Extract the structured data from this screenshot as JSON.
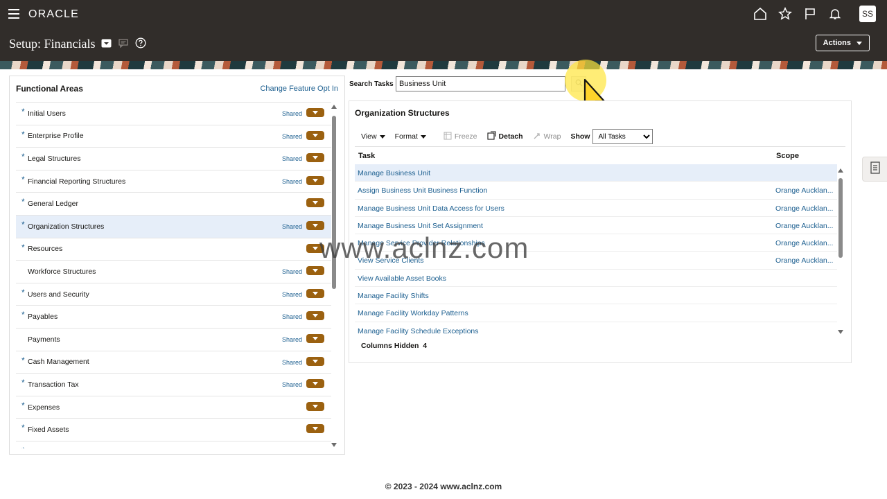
{
  "app": {
    "brand": "ORACLE",
    "page_title": "Setup: Financials",
    "actions_label": "Actions",
    "avatar_initials": "SS"
  },
  "left_panel": {
    "title": "Functional Areas",
    "link": "Change Feature Opt In",
    "items": [
      {
        "label": "Initial Users",
        "required": true,
        "shared": "Shared",
        "selected": false
      },
      {
        "label": "Enterprise Profile",
        "required": true,
        "shared": "Shared",
        "selected": false
      },
      {
        "label": "Legal Structures",
        "required": true,
        "shared": "Shared",
        "selected": false
      },
      {
        "label": "Financial Reporting Structures",
        "required": true,
        "shared": "Shared",
        "selected": false
      },
      {
        "label": "General Ledger",
        "required": true,
        "shared": "",
        "selected": false
      },
      {
        "label": "Organization Structures",
        "required": true,
        "shared": "Shared",
        "selected": true
      },
      {
        "label": "Resources",
        "required": true,
        "shared": "",
        "selected": false
      },
      {
        "label": "Workforce Structures",
        "required": false,
        "shared": "Shared",
        "selected": false
      },
      {
        "label": "Users and Security",
        "required": true,
        "shared": "Shared",
        "selected": false
      },
      {
        "label": "Payables",
        "required": true,
        "shared": "Shared",
        "selected": false
      },
      {
        "label": "Payments",
        "required": false,
        "shared": "Shared",
        "selected": false
      },
      {
        "label": "Cash Management",
        "required": true,
        "shared": "Shared",
        "selected": false
      },
      {
        "label": "Transaction Tax",
        "required": true,
        "shared": "Shared",
        "selected": false
      },
      {
        "label": "Expenses",
        "required": true,
        "shared": "",
        "selected": false
      },
      {
        "label": "Fixed Assets",
        "required": true,
        "shared": "",
        "selected": false
      },
      {
        "label": "",
        "required": true,
        "shared": "",
        "selected": false
      }
    ]
  },
  "search": {
    "label": "Search Tasks",
    "value": "Business Unit"
  },
  "main": {
    "title": "Organization Structures",
    "toolbar": {
      "view": "View",
      "format": "Format",
      "freeze": "Freeze",
      "detach": "Detach",
      "wrap": "Wrap",
      "show": "Show",
      "show_value": "All Tasks"
    },
    "columns": {
      "task": "Task",
      "scope": "Scope"
    },
    "rows": [
      {
        "task": "Manage Business Unit",
        "scope": "",
        "selected": true
      },
      {
        "task": "Assign Business Unit Business Function",
        "scope": "Orange Aucklan...",
        "selected": false
      },
      {
        "task": "Manage Business Unit Data Access for Users",
        "scope": "Orange Aucklan...",
        "selected": false
      },
      {
        "task": "Manage Business Unit Set Assignment",
        "scope": "Orange Aucklan...",
        "selected": false
      },
      {
        "task": "Manage Service Provider Relationships",
        "scope": "Orange Aucklan...",
        "selected": false
      },
      {
        "task": "View Service Clients",
        "scope": "Orange Aucklan...",
        "selected": false
      },
      {
        "task": "View Available Asset Books",
        "scope": "",
        "selected": false
      },
      {
        "task": "Manage Facility Shifts",
        "scope": "",
        "selected": false
      },
      {
        "task": "Manage Facility Workday Patterns",
        "scope": "",
        "selected": false
      },
      {
        "task": "Manage Facility Schedule Exceptions",
        "scope": "",
        "selected": false
      }
    ],
    "columns_hidden_label": "Columns Hidden",
    "columns_hidden_count": "4"
  },
  "overlay": {
    "watermark": "www.aclnz.com",
    "footer": "© 2023 - 2024 www.aclnz.com"
  },
  "colors": {
    "header_bg": "#312d2a",
    "link": "#1b5e8f",
    "dropdown_badge": "#9b6110",
    "selected_row": "#e6eef9"
  }
}
